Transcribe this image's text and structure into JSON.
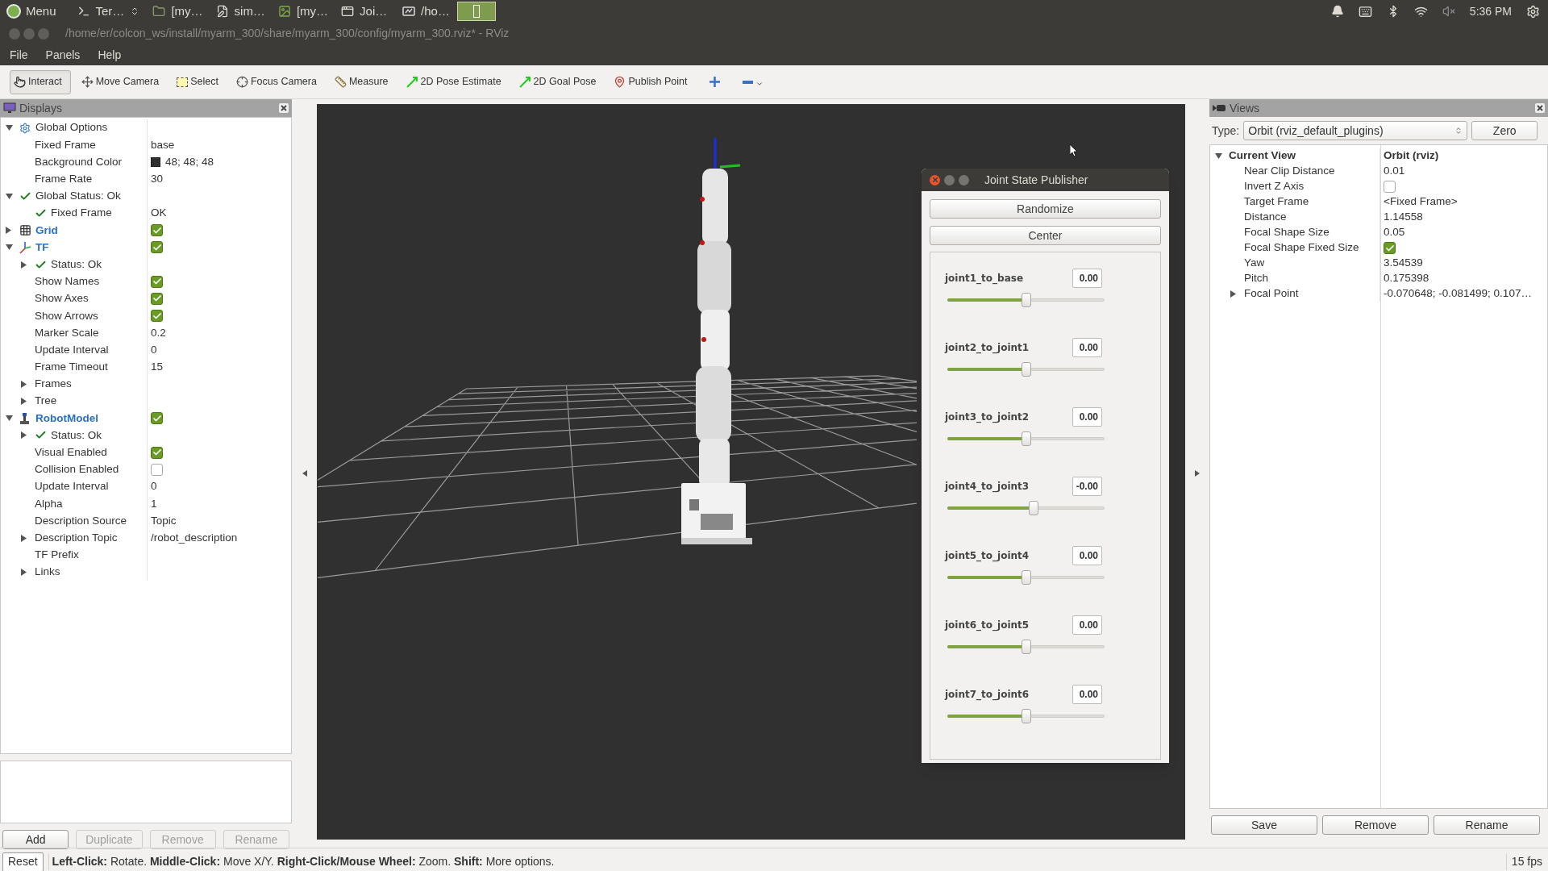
{
  "top_panel": {
    "menu": "Menu",
    "tasks": [
      {
        "kind": "terminal",
        "label": "Ter…",
        "selected": false
      },
      {
        "kind": "folder",
        "label": "[my…",
        "selected": false
      },
      {
        "kind": "editor",
        "label": "sim…",
        "selected": false
      },
      {
        "kind": "image",
        "label": "[my…",
        "selected": false
      },
      {
        "kind": "window",
        "label": "Joi…",
        "selected": false
      },
      {
        "kind": "rviz",
        "label": "/ho…",
        "selected": false
      },
      {
        "kind": "thumbnail",
        "selected": true
      }
    ],
    "clock": "5:36 PM"
  },
  "window": {
    "title": "/home/er/colcon_ws/install/myarm_300/share/myarm_300/config/myarm_300.rviz* - RViz"
  },
  "menu_bar": [
    "File",
    "Panels",
    "Help"
  ],
  "toolbar": [
    {
      "kind": "interact",
      "label": "Interact",
      "selected": true
    },
    {
      "kind": "move",
      "label": "Move Camera",
      "selected": false
    },
    {
      "kind": "select",
      "label": "Select",
      "selected": false
    },
    {
      "kind": "focus",
      "label": "Focus Camera",
      "selected": false
    },
    {
      "kind": "measure",
      "label": "Measure",
      "selected": false
    },
    {
      "kind": "pose",
      "label": "2D Pose Estimate",
      "selected": false
    },
    {
      "kind": "goal",
      "label": "2D Goal Pose",
      "selected": false
    },
    {
      "kind": "point",
      "label": "Publish Point",
      "selected": false
    },
    {
      "kind": "add",
      "selected": false
    },
    {
      "kind": "remove",
      "selected": false
    }
  ],
  "displays": {
    "title": "Displays",
    "tree": [
      {
        "kind": "options",
        "name": "Global Options",
        "expanded": true,
        "children": [
          {
            "kind": "property",
            "name": "Fixed Frame",
            "value": "base"
          },
          {
            "kind": "color",
            "name": "Background Color",
            "value": "48; 48; 48"
          },
          {
            "kind": "property",
            "name": "Frame Rate",
            "value": "30"
          }
        ]
      },
      {
        "kind": "status",
        "name": "Global Status: Ok",
        "expanded": true,
        "children": [
          {
            "kind": "status",
            "name": "Fixed Frame",
            "value": "OK"
          }
        ]
      },
      {
        "kind": "grid",
        "name": "Grid",
        "expanded": false,
        "checked": true
      },
      {
        "kind": "tf",
        "name": "TF",
        "expanded": true,
        "checked": true,
        "children": [
          {
            "kind": "status",
            "name": "Status: Ok",
            "expanded": false
          },
          {
            "kind": "checkbox",
            "name": "Show Names",
            "checked": true
          },
          {
            "kind": "checkbox",
            "name": "Show Axes",
            "checked": true
          },
          {
            "kind": "checkbox",
            "name": "Show Arrows",
            "checked": true
          },
          {
            "kind": "property",
            "name": "Marker Scale",
            "value": "0.2"
          },
          {
            "kind": "property",
            "name": "Update Interval",
            "value": "0"
          },
          {
            "kind": "property",
            "name": "Frame Timeout",
            "value": "15"
          },
          {
            "kind": "property",
            "name": "Frames",
            "expanded": false
          },
          {
            "kind": "property",
            "name": "Tree",
            "expanded": false
          }
        ]
      },
      {
        "kind": "robot",
        "name": "RobotModel",
        "expanded": true,
        "checked": true,
        "children": [
          {
            "kind": "status",
            "name": "Status: Ok",
            "expanded": false
          },
          {
            "kind": "checkbox",
            "name": "Visual Enabled",
            "checked": true
          },
          {
            "kind": "checkbox",
            "name": "Collision Enabled",
            "checked": false
          },
          {
            "kind": "property",
            "name": "Update Interval",
            "value": "0"
          },
          {
            "kind": "property",
            "name": "Alpha",
            "value": "1"
          },
          {
            "kind": "property",
            "name": "Description Source",
            "value": "Topic"
          },
          {
            "kind": "property",
            "name": "Description Topic",
            "value": "/robot_description",
            "expanded": false
          },
          {
            "kind": "property",
            "name": "TF Prefix"
          },
          {
            "kind": "property",
            "name": "Links",
            "expanded": false
          }
        ]
      }
    ],
    "buttons": [
      {
        "label": "Add",
        "disabled": false
      },
      {
        "label": "Duplicate",
        "disabled": true
      },
      {
        "label": "Remove",
        "disabled": true
      },
      {
        "label": "Rename",
        "disabled": true
      }
    ]
  },
  "views": {
    "title": "Views",
    "type_label": "Type:",
    "type_value": "Orbit (rviz_default_plugins)",
    "zero": "Zero",
    "tree": [
      {
        "kind": "header",
        "name": "Current View",
        "value": "Orbit (rviz)",
        "expanded": true,
        "children": [
          {
            "kind": "property",
            "name": "Near Clip Distance",
            "value": "0.01"
          },
          {
            "kind": "checkbox",
            "name": "Invert Z Axis",
            "checked": false
          },
          {
            "kind": "property",
            "name": "Target Frame",
            "value": "<Fixed Frame>"
          },
          {
            "kind": "property",
            "name": "Distance",
            "value": "1.14558"
          },
          {
            "kind": "property",
            "name": "Focal Shape Size",
            "value": "0.05"
          },
          {
            "kind": "checkbox",
            "name": "Focal Shape Fixed Size",
            "checked": true
          },
          {
            "kind": "property",
            "name": "Yaw",
            "value": "3.54539"
          },
          {
            "kind": "property",
            "name": "Pitch",
            "value": "0.175398"
          },
          {
            "kind": "property",
            "name": "Focal Point",
            "value": "-0.070648; -0.081499; 0.107…",
            "expanded": false
          }
        ]
      }
    ],
    "buttons": [
      "Save",
      "Remove",
      "Rename"
    ]
  },
  "joint_state_publisher": {
    "title": "Joint State Publisher",
    "buttons": [
      "Randomize",
      "Center"
    ],
    "joints": [
      {
        "name": "joint1_to_base",
        "value": "0.00",
        "level": 0.5
      },
      {
        "name": "joint2_to_joint1",
        "value": "0.00",
        "level": 0.5
      },
      {
        "name": "joint3_to_joint2",
        "value": "0.00",
        "level": 0.5
      },
      {
        "name": "joint4_to_joint3",
        "value": "-0.00",
        "level": 0.55
      },
      {
        "name": "joint5_to_joint4",
        "value": "0.00",
        "level": 0.5
      },
      {
        "name": "joint6_to_joint5",
        "value": "0.00",
        "level": 0.5
      },
      {
        "name": "joint7_to_joint6",
        "value": "0.00",
        "level": 0.5
      }
    ]
  },
  "status_bar": {
    "reset": "Reset",
    "hint": "**Left-Click:** Rotate. **Middle-Click:** Move X/Y. **Right-Click/Mouse Wheel:** Zoom. **Shift:** More options.",
    "fps": "15 fps"
  }
}
